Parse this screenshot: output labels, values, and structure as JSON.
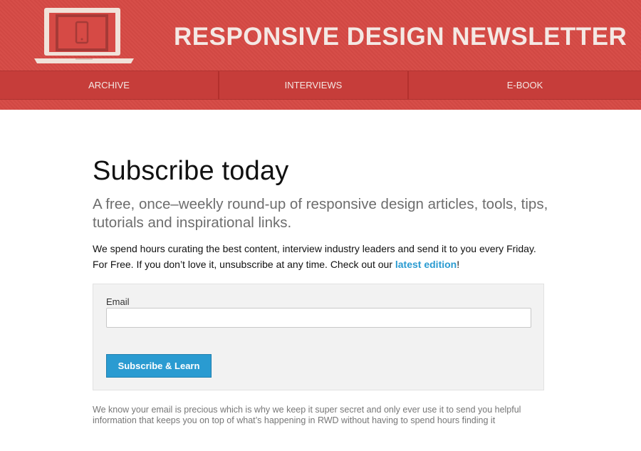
{
  "header": {
    "title": "RESPONSIVE DESIGN NEWSLETTER",
    "logo_icon": "laptop-phone-icon",
    "background_color": "#d64a45"
  },
  "nav": {
    "items": [
      {
        "label": "ARCHIVE"
      },
      {
        "label": "INTERVIEWS"
      },
      {
        "label": "E-BOOK"
      }
    ]
  },
  "main": {
    "title": "Subscribe today",
    "lead": "A free, once–weekly round-up of responsive design articles, tools, tips, tutorials and inspirational links.",
    "intro_text": "We spend hours curating the best content, interview industry leaders and send it to you every Friday. For Free. If you don’t love it, unsubscribe at any time. Check out our ",
    "intro_link": "latest edition",
    "intro_end": "!",
    "link_color": "#2a9bd1"
  },
  "form": {
    "email_label": "Email",
    "email_value": "",
    "submit_label": "Subscribe & Learn",
    "button_color": "#2a9bd1"
  },
  "footer": {
    "privacy_text": "We know your email is precious which is why we keep it super secret and only ever use it to send you helpful information that keeps you on top of what’s happening in RWD without having to spend hours finding it"
  }
}
